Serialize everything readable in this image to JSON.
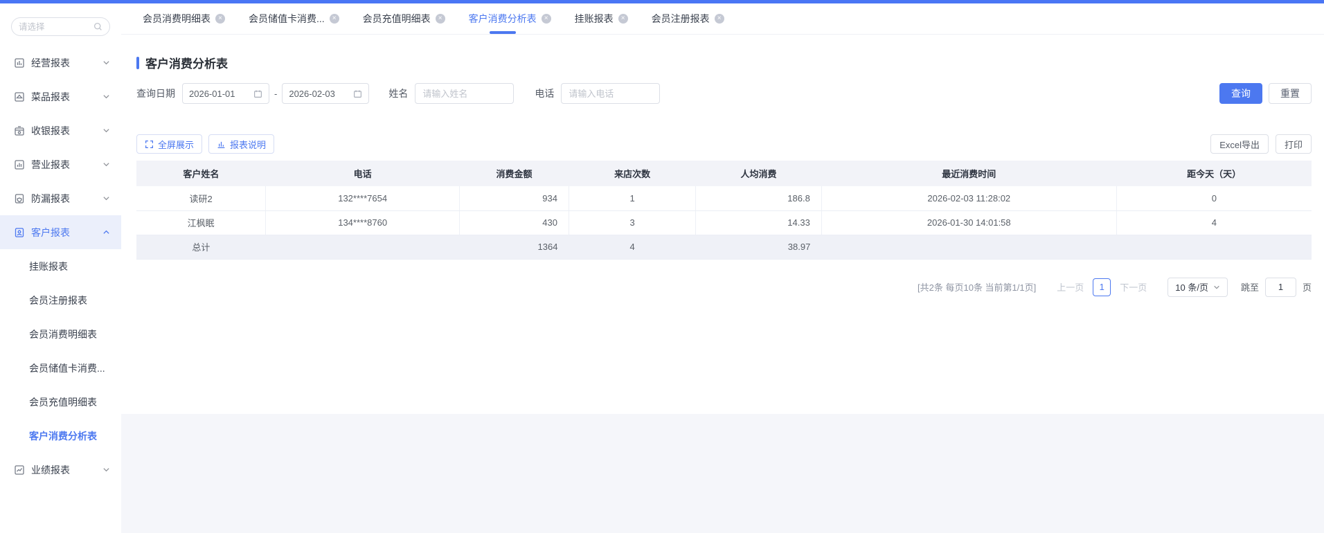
{
  "sidebar": {
    "search_placeholder": "请选择",
    "groups": [
      {
        "label": "经营报表"
      },
      {
        "label": "菜品报表"
      },
      {
        "label": "收银报表"
      },
      {
        "label": "营业报表"
      },
      {
        "label": "防漏报表"
      },
      {
        "label": "客户报表"
      },
      {
        "label": "业绩报表"
      }
    ],
    "customer_children": [
      {
        "label": "挂账报表"
      },
      {
        "label": "会员注册报表"
      },
      {
        "label": "会员消费明细表"
      },
      {
        "label": "会员储值卡消费..."
      },
      {
        "label": "会员充值明细表"
      },
      {
        "label": "客户消费分析表"
      }
    ]
  },
  "tabs": [
    {
      "label": "会员消费明细表"
    },
    {
      "label": "会员储值卡消费..."
    },
    {
      "label": "会员充值明细表"
    },
    {
      "label": "客户消费分析表"
    },
    {
      "label": "挂账报表"
    },
    {
      "label": "会员注册报表"
    }
  ],
  "page": {
    "title": "客户消费分析表"
  },
  "filters": {
    "date_label": "查询日期",
    "date_start": "2026-01-01",
    "date_separator": "-",
    "date_end": "2026-02-03",
    "name_label": "姓名",
    "name_placeholder": "请输入姓名",
    "phone_label": "电话",
    "phone_placeholder": "请输入电话",
    "query_button": "查询",
    "reset_button": "重置"
  },
  "toolbar": {
    "fullscreen": "全屏展示",
    "report_info": "报表说明",
    "excel_export": "Excel导出",
    "print": "打印"
  },
  "table": {
    "columns": [
      "客户姓名",
      "电话",
      "消费金额",
      "来店次数",
      "人均消费",
      "最近消费时间",
      "距今天（天）"
    ],
    "rows": [
      {
        "cells": [
          "读研2",
          "132****7654",
          "934",
          "1",
          "186.8",
          "2026-02-03 11:28:02",
          "0"
        ]
      },
      {
        "cells": [
          "江枫眠",
          "134****8760",
          "430",
          "3",
          "14.33",
          "2026-01-30 14:01:58",
          "4"
        ]
      }
    ],
    "total": {
      "cells": [
        "总计",
        "",
        "1364",
        "4",
        "38.97",
        "",
        ""
      ]
    }
  },
  "pagination": {
    "summary": "[共2条 每页10条 当前第1/1页]",
    "prev": "上一页",
    "current_page": "1",
    "next": "下一页",
    "page_size": "10 条/页",
    "jump_label": "跳至",
    "jump_value": "1",
    "jump_unit": "页"
  },
  "colors": {
    "primary": "#4C78F0",
    "topbar": "#4A76F5",
    "active_bg": "#EBEFFB"
  }
}
